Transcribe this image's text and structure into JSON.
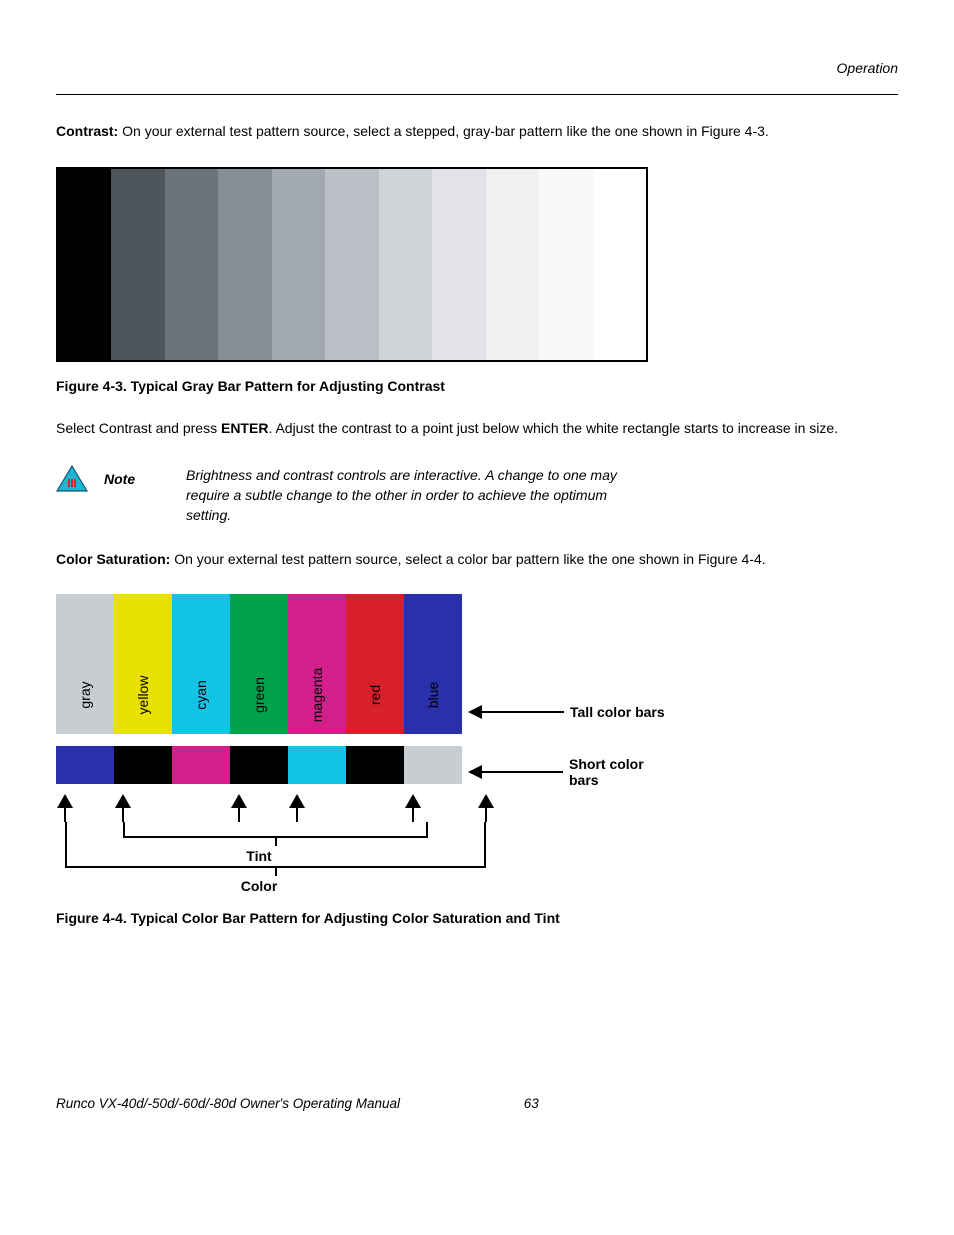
{
  "header": {
    "section": "Operation"
  },
  "contrast": {
    "label": "Contrast:",
    "text": " On your external test pattern source, select a stepped, gray-bar pattern like the one shown in Figure 4-3."
  },
  "gray_bars": [
    "#000000",
    "#4e555b",
    "#6b747b",
    "#858d95",
    "#a3a9b1",
    "#bbbfc6",
    "#d0d3d8",
    "#e1e3e7",
    "#eef0f2",
    "#f8f8f9",
    "#ffffff"
  ],
  "fig43_caption": "Figure 4-3. Typical Gray Bar Pattern for Adjusting Contrast",
  "contrast_instr": {
    "pre": "Select Contrast and press ",
    "enter": "ENTER",
    "post": ". Adjust the contrast to a point just below which the white rectangle starts to increase in size."
  },
  "note": {
    "label": "Note",
    "text": "Brightness and contrast controls are interactive. A change to one may require a subtle change to the other in order to achieve the optimum setting."
  },
  "colorsat": {
    "label": "Color Saturation:",
    "text": " On your external test pattern source, select a color bar pattern like the one shown in Figure 4-4."
  },
  "tall_bars": [
    {
      "label": "gray",
      "bg": "#c8cdd1",
      "fg": "#000"
    },
    {
      "label": "yellow",
      "bg": "#e8e100",
      "fg": "#000"
    },
    {
      "label": "cyan",
      "bg": "#13c3e5",
      "fg": "#000"
    },
    {
      "label": "green",
      "bg": "#00a24b",
      "fg": "#000"
    },
    {
      "label": "magenta",
      "bg": "#d41f8a",
      "fg": "#000"
    },
    {
      "label": "red",
      "bg": "#d8202a",
      "fg": "#000"
    },
    {
      "label": "blue",
      "bg": "#2a2faa",
      "fg": "#000"
    }
  ],
  "short_bars": [
    "#2a2faa",
    "#000000",
    "#d41f8a",
    "#000000",
    "#13c3e5",
    "#000000",
    "#c8cdd1"
  ],
  "labels": {
    "tall": "Tall color bars",
    "short": "Short color bars",
    "tint": "Tint",
    "color": "Color"
  },
  "fig44_caption": "Figure 4-4. Typical Color Bar Pattern for Adjusting Color Saturation and Tint",
  "footer": {
    "text": "Runco VX-40d/-50d/-60d/-80d Owner's Operating Manual",
    "page": "63"
  }
}
